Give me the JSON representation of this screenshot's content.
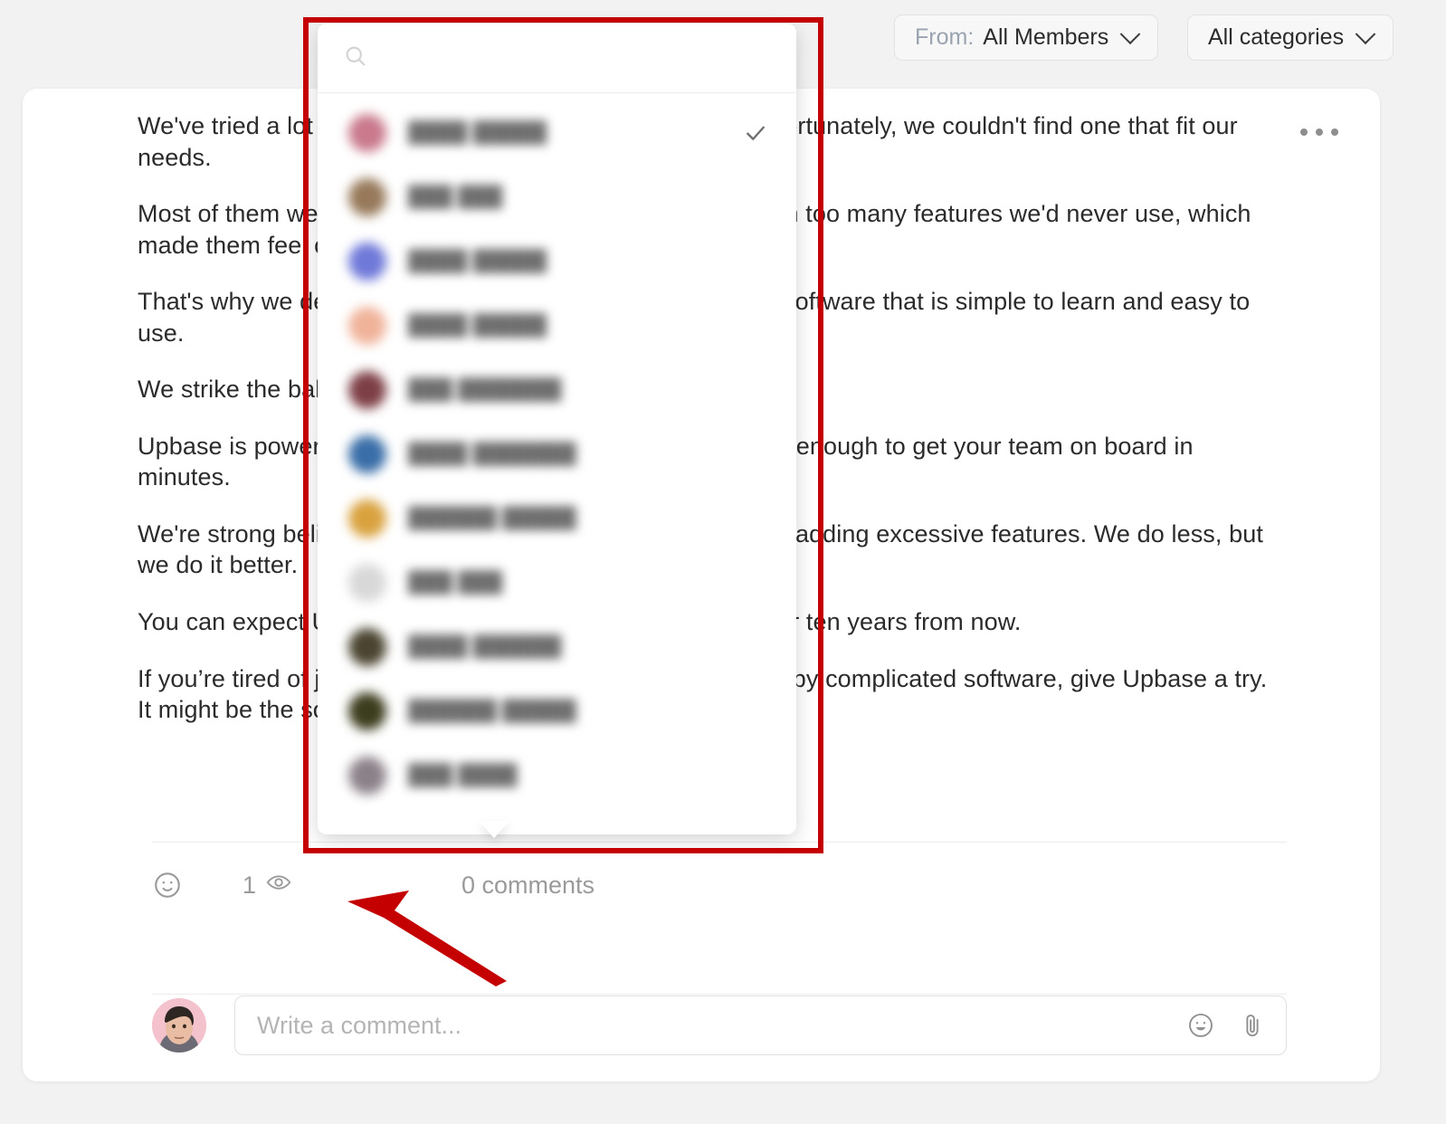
{
  "topbar": {
    "from_filter": {
      "prefix": "From:",
      "value": "All Members",
      "chevron_icon": "chevron-down-icon"
    },
    "category_filter": {
      "value": "All categories",
      "chevron_icon": "chevron-down-icon"
    }
  },
  "post": {
    "paragraphs": [
      "We've tried a lot of work management software as well. Unfortunately, we couldn't find one that fit our needs.",
      "Most of them were too complicated or they were packed with too many features we'd never use, which made them feel overwhelming!",
      "That's why we decided to build our own work management software that is simple to learn and easy to use.",
      "We strike the balance between power and simplicity.",
      "Upbase is powerful enough to run your business, yet simple enough to get your team on board in minutes.",
      "We're strong believers in getting the details right rather than adding excessive features. We do less, but we do it better.",
      "You can expect Upbase to remain simple to use, even five or ten years from now.",
      "If you’re tired of juggling multiple tools, or feel overwhelmed by complicated software, give Upbase a try. It might be the solution you’re looking for."
    ],
    "more_menu_label": "More options"
  },
  "meta": {
    "reaction_icon": "smiley-icon",
    "views_count": "1",
    "views_icon": "eye-icon",
    "comments_label": "0 comments"
  },
  "composer": {
    "avatar_name": "user-avatar",
    "placeholder": "Write a comment...",
    "value": "",
    "emoji_icon": "smiley-icon",
    "attach_icon": "paperclip-icon"
  },
  "member_dropdown": {
    "search_placeholder": "",
    "search_value": "",
    "search_icon": "search-icon",
    "selected_check_icon": "check-icon",
    "rows": [
      {
        "name": "████ █████",
        "avatar_color": "#c9798b",
        "selected": true
      },
      {
        "name": "███ ███",
        "avatar_color": "#97795a",
        "selected": false
      },
      {
        "name": "████ █████",
        "avatar_color": "#6f79d8",
        "selected": false
      },
      {
        "name": "████ █████",
        "avatar_color": "#f0b39a",
        "selected": false
      },
      {
        "name": "███ ███████",
        "avatar_color": "#7d3f46",
        "selected": false
      },
      {
        "name": "████ ███████",
        "avatar_color": "#3a6ea8",
        "selected": false
      },
      {
        "name": "██████ █████",
        "avatar_color": "#d9a23f",
        "selected": false
      },
      {
        "name": "███ ███",
        "avatar_color": "#d8d8d8",
        "selected": false
      },
      {
        "name": "████ ██████",
        "avatar_color": "#4a4430",
        "selected": false
      },
      {
        "name": "██████ █████",
        "avatar_color": "#3c3c1e",
        "selected": false
      },
      {
        "name": "███ ████",
        "avatar_color": "#8b8289",
        "selected": false
      }
    ]
  },
  "annotations": {
    "highlight_color": "#c50000",
    "rect_label": "member-dropdown-highlight",
    "arrow_label": "points-to-view-count"
  }
}
